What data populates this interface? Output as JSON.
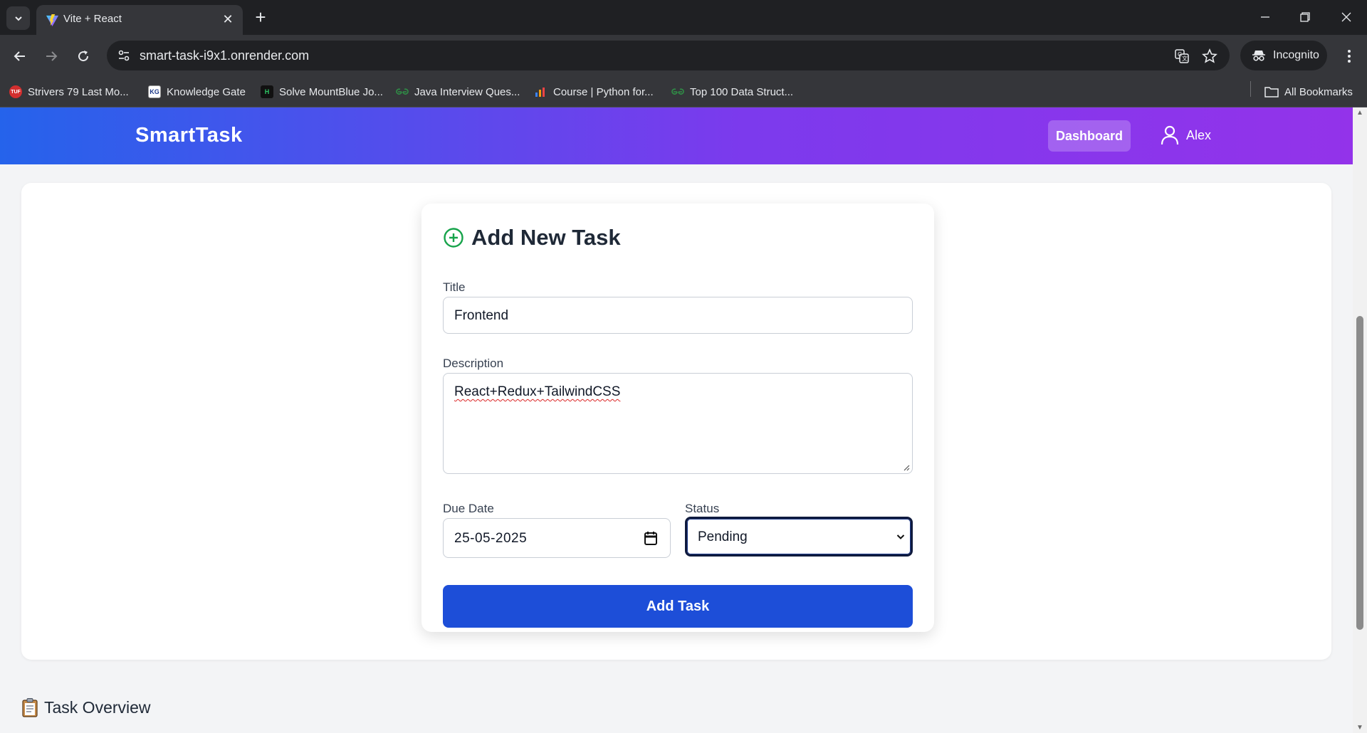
{
  "browser": {
    "tab_title": "Vite + React",
    "url": "smart-task-i9x1.onrender.com",
    "incognito_label": "Incognito",
    "bookmarks": [
      {
        "label": "Strivers 79 Last Mo...",
        "icon": "tuf-icon",
        "badge": "TUF",
        "color": "#d32f2f"
      },
      {
        "label": "Knowledge Gate",
        "icon": "kg-icon",
        "badge": "KG",
        "color": "#ffffff"
      },
      {
        "label": "Solve MountBlue Jo...",
        "icon": "hackerrank-icon",
        "badge": "H",
        "color": "#111111"
      },
      {
        "label": "Java Interview Ques...",
        "icon": "gfg-icon",
        "badge": "",
        "color": "#2f8d46"
      },
      {
        "label": "Course | Python for...",
        "icon": "course-icon",
        "badge": "",
        "color": "#3b82f6"
      },
      {
        "label": "Top 100 Data Struct...",
        "icon": "gfg-icon",
        "badge": "",
        "color": "#2f8d46"
      }
    ],
    "all_bookmarks_label": "All Bookmarks"
  },
  "navbar": {
    "brand": "SmartTask",
    "dashboard_label": "Dashboard",
    "user_name": "Alex"
  },
  "form": {
    "title": "Add New Task",
    "title_label": "Title",
    "title_value": "Frontend",
    "description_label": "Description",
    "description_value": "React+Redux+TailwindCSS",
    "due_date_label": "Due Date",
    "due_date_value": "25-05-2025",
    "status_label": "Status",
    "status_value": "Pending",
    "submit_label": "Add Task"
  },
  "overview": {
    "title": "Task Overview"
  },
  "colors": {
    "navbar_gradient_start": "#2563eb",
    "navbar_gradient_end": "#9333ea",
    "submit_button": "#1d4ed8",
    "add_icon": "#16a34a"
  }
}
